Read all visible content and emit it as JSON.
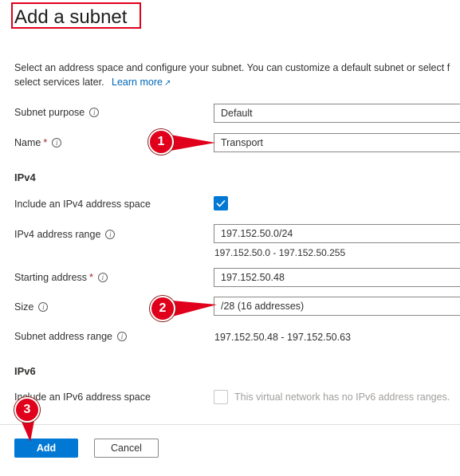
{
  "title": "Add a subnet",
  "description": {
    "line1": "Select an address space and configure your subnet. You can customize a default subnet or select f",
    "line2": "select services later.",
    "link": "Learn more",
    "link_icon": "external-link-icon"
  },
  "fields": {
    "subnet_purpose": {
      "label": "Subnet purpose",
      "value": "Default"
    },
    "name": {
      "label": "Name",
      "required": "*",
      "value": "Transport"
    }
  },
  "ipv4": {
    "heading": "IPv4",
    "include_label": "Include an IPv4 address space",
    "include_checked": true,
    "range_label": "IPv4 address range",
    "range_value": "197.152.50.0/24",
    "range_hint": "197.152.50.0 - 197.152.50.255",
    "starting_label": "Starting address",
    "starting_required": "*",
    "starting_value": "197.152.50.48",
    "size_label": "Size",
    "size_value": "/28 (16 addresses)",
    "subnet_range_label": "Subnet address range",
    "subnet_range_value": "197.152.50.48 - 197.152.50.63"
  },
  "ipv6": {
    "heading": "IPv6",
    "include_label": "Include an IPv6 address space",
    "include_checked": false,
    "disabled_text": "This virtual network has no IPv6 address ranges."
  },
  "footer": {
    "add_label": "Add",
    "cancel_label": "Cancel"
  },
  "callouts": {
    "one": "1",
    "two": "2",
    "three": "3"
  },
  "colors": {
    "accent": "#0078d4",
    "callout_red": "#e0001b",
    "link": "#0067b8"
  }
}
